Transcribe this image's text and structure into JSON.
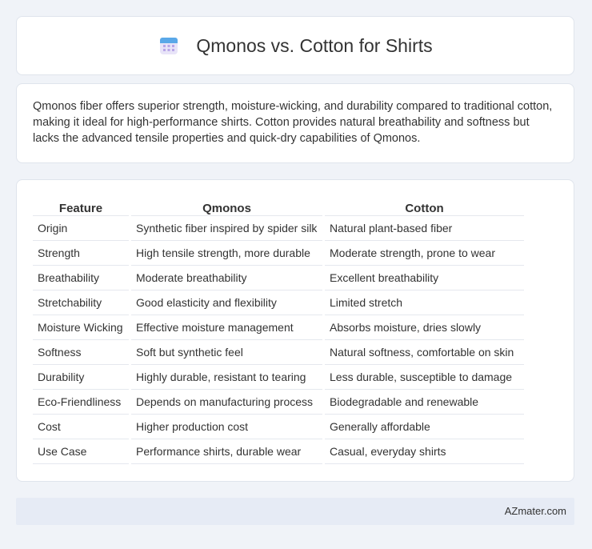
{
  "header": {
    "title": "Qmonos vs. Cotton for Shirts",
    "icon": "calendar-icon"
  },
  "summary": "Qmonos fiber offers superior strength, moisture-wicking, and durability compared to traditional cotton, making it ideal for high-performance shirts. Cotton provides natural breathability and softness but lacks the advanced tensile properties and quick-dry capabilities of Qmonos.",
  "table": {
    "headers": [
      "Feature",
      "Qmonos",
      "Cotton"
    ],
    "rows": [
      [
        "Origin",
        "Synthetic fiber inspired by spider silk",
        "Natural plant-based fiber"
      ],
      [
        "Strength",
        "High tensile strength, more durable",
        "Moderate strength, prone to wear"
      ],
      [
        "Breathability",
        "Moderate breathability",
        "Excellent breathability"
      ],
      [
        "Stretchability",
        "Good elasticity and flexibility",
        "Limited stretch"
      ],
      [
        "Moisture Wicking",
        "Effective moisture management",
        "Absorbs moisture, dries slowly"
      ],
      [
        "Softness",
        "Soft but synthetic feel",
        "Natural softness, comfortable on skin"
      ],
      [
        "Durability",
        "Highly durable, resistant to tearing",
        "Less durable, susceptible to damage"
      ],
      [
        "Eco-Friendliness",
        "Depends on manufacturing process",
        "Biodegradable and renewable"
      ],
      [
        "Cost",
        "Higher production cost",
        "Generally affordable"
      ],
      [
        "Use Case",
        "Performance shirts, durable wear",
        "Casual, everyday shirts"
      ]
    ]
  },
  "footer": {
    "site": "AZmater.com"
  }
}
